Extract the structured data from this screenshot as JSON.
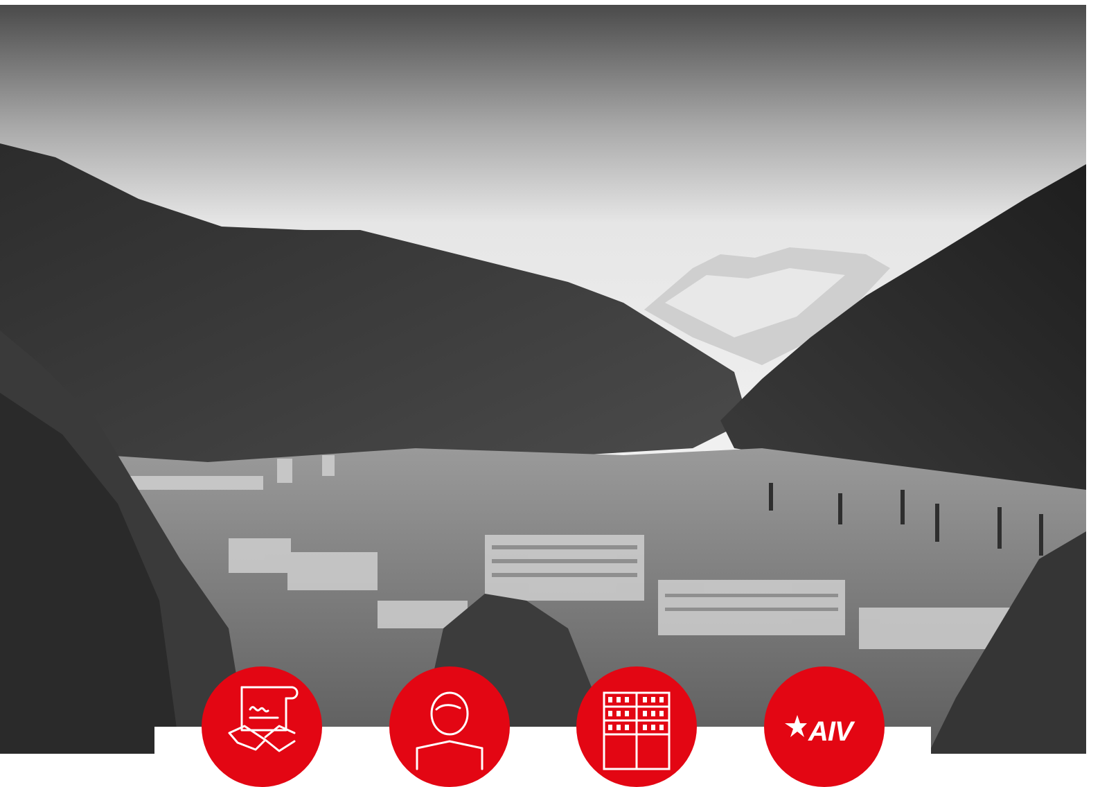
{
  "hero": {
    "image_description_icon": "mountain-valley-town-photo",
    "tone": "black-and-white"
  },
  "features": [
    {
      "icon": "contract-handshake-icon"
    },
    {
      "icon": "person-reading-icon"
    },
    {
      "icon": "building-facade-icon"
    },
    {
      "icon": "aiv-logo-icon",
      "logo_text": "AIV"
    }
  ],
  "colors": {
    "accent": "#e30613",
    "bar": "#ffffff"
  }
}
